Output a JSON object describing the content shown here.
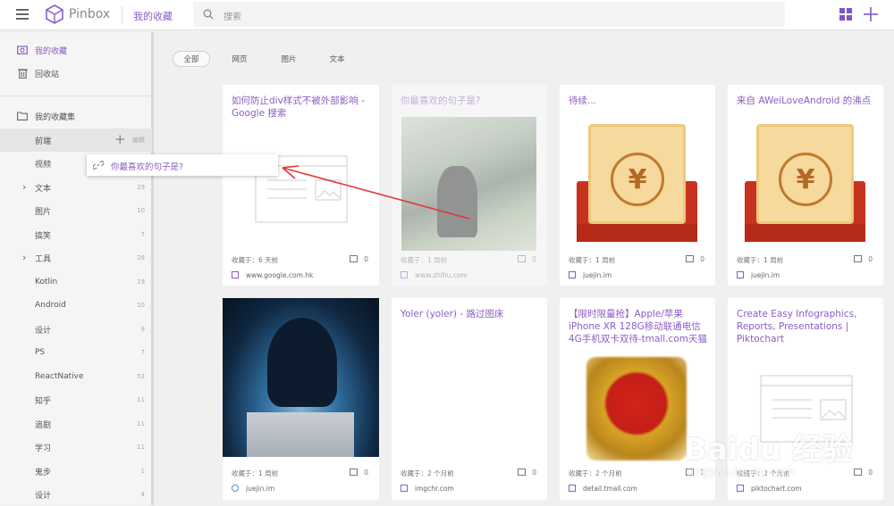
{
  "app": {
    "name": "Pinbox",
    "section": "我的收藏"
  },
  "search": {
    "placeholder": "搜索"
  },
  "sidebar": {
    "top": [
      {
        "label": "我的收藏"
      },
      {
        "label": "回收站"
      }
    ],
    "collections_header": "我的收藏集",
    "items": [
      {
        "label": "前端",
        "count": "编辑",
        "add": "+"
      },
      {
        "label": "视频",
        "count": ""
      },
      {
        "label": "文本",
        "count": "29"
      },
      {
        "label": "图片",
        "count": "10"
      },
      {
        "label": "搞笑",
        "count": "7"
      },
      {
        "label": "工具",
        "count": "28"
      },
      {
        "label": "Kotlin",
        "count": "19"
      },
      {
        "label": "Android",
        "count": "10"
      },
      {
        "label": "设计",
        "count": "9"
      },
      {
        "label": "PS",
        "count": "7"
      },
      {
        "label": "ReactNative",
        "count": "53"
      },
      {
        "label": "知乎",
        "count": "11"
      },
      {
        "label": "追剧",
        "count": "11"
      },
      {
        "label": "学习",
        "count": "11"
      },
      {
        "label": "鬼步",
        "count": "1"
      },
      {
        "label": "设计",
        "count": "4"
      }
    ]
  },
  "filters": [
    "全部",
    "网页",
    "图片",
    "文本"
  ],
  "drag_tooltip": {
    "label": "你最喜欢的句子是?"
  },
  "cards": [
    {
      "title": "如何防止div样式不被外部影响 - Google 搜索",
      "meta": "收藏于：6 天前",
      "count": "0",
      "site": "www.google.com.hk"
    },
    {
      "title": "你最喜欢的句子是?",
      "meta": "收藏于：1 周前",
      "count": "0",
      "site": "www.zhihu.com"
    },
    {
      "title": "待续...",
      "meta": "收藏于：1 周前",
      "count": "0",
      "site": "juejin.im"
    },
    {
      "title": "来自 AWeiLoveAndroid 的沸点",
      "meta": "收藏于：1 周前",
      "count": "0",
      "site": "juejin.im"
    },
    {
      "title": "",
      "meta": "收藏于：1 周前",
      "count": "0",
      "site": "juejin.im"
    },
    {
      "title": "Yoler (yoler) - 路过图床",
      "meta": "收藏于：2 个月前",
      "count": "0",
      "site": "imgchr.com"
    },
    {
      "title": "【限时限量抢】Apple/苹果 iPhone XR 128G移动联通电信4G手机双卡双待-tmall.com天猫",
      "meta": "收藏于：2 个月前",
      "count": "1",
      "site": "detail.tmall.com"
    },
    {
      "title": "Create Easy Infographics, Reports, Presentations | Piktochart",
      "meta": "收藏于：2 个月前",
      "count": "0",
      "site": "piktochart.com"
    }
  ],
  "watermark": {
    "brand": "Baidu 经验",
    "url": "jingyan.baidu.com"
  },
  "colors": {
    "accent": "#8b5dc4",
    "sidebar_bg": "#f5f5f5",
    "page_bg": "#f0f0f0"
  }
}
